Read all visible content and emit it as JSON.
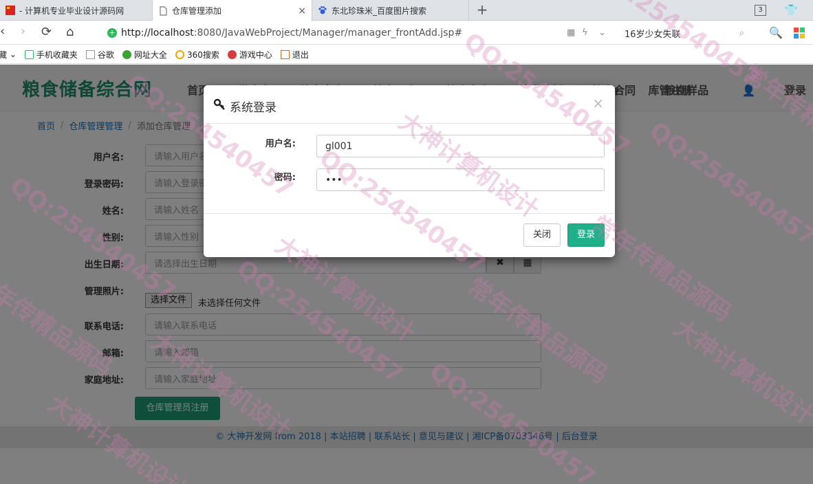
{
  "browser": {
    "tabs": [
      {
        "title": "- 计算机专业毕业设计源码网"
      },
      {
        "title": "仓库管理添加",
        "close": "×"
      },
      {
        "title": "东北珍珠米_百度图片搜索"
      }
    ],
    "new_tab": "+",
    "tab_count": "3",
    "url_host": "http://localhost",
    "url_path": ":8080/JavaWebProject/Manager/manager_frontAdd.jsp#",
    "search_text": "16岁少女失联",
    "bookmarks": [
      "藏",
      "手机收藏夹",
      "谷歌",
      "网址大全",
      "360搜索",
      "游戏中心",
      "退出"
    ]
  },
  "site": {
    "logo": "粮食储备综合网",
    "nav": [
      "首页",
      "供应商",
      "粮食盘点",
      "粮食入库",
      "粮食出库",
      "粮食计划",
      "粮食合同",
      "粮食样品"
    ],
    "right_nav": [
      "库管注册",
      "登录"
    ],
    "breadcrumb": [
      "首页",
      "仓库管理管理",
      "添加仓库管理"
    ],
    "form": {
      "fields": [
        {
          "label": "用户名:",
          "placeholder": "请输入用户名"
        },
        {
          "label": "登录密码:",
          "placeholder": "请输入登录密码"
        },
        {
          "label": "姓名:",
          "placeholder": "请输入姓名"
        },
        {
          "label": "性别:",
          "placeholder": "请输入性别"
        },
        {
          "label": "出生日期:",
          "placeholder": "请选择出生日期"
        }
      ],
      "photo_label": "管理照片:",
      "file_button": "选择文件",
      "file_none": "未选择任何文件",
      "fields2": [
        {
          "label": "联系电话:",
          "placeholder": "请输入联系电话"
        },
        {
          "label": "邮箱:",
          "placeholder": "请输入邮箱"
        },
        {
          "label": "家庭地址:",
          "placeholder": "请输入家庭地址"
        }
      ],
      "submit": "仓库管理员注册"
    },
    "footer": "© 大神开发网 from 2018 | 本站招聘 | 联系站长 | 意见与建议 | 湘ICP备0703346号 | 后台登录"
  },
  "modal": {
    "title": "系统登录",
    "close_x": "×",
    "username_label": "用户名:",
    "username_value": "gl001",
    "password_label": "密码:",
    "password_value": "•••",
    "close_button": "关闭",
    "login_button": "登录"
  },
  "watermarks": [
    "QQ:254540457",
    "大神计算机设计",
    "常年传精品源码"
  ],
  "colors": {
    "brand": "#1f8f6e",
    "primary_btn": "#1fb08a",
    "link": "#1f6fb2"
  }
}
